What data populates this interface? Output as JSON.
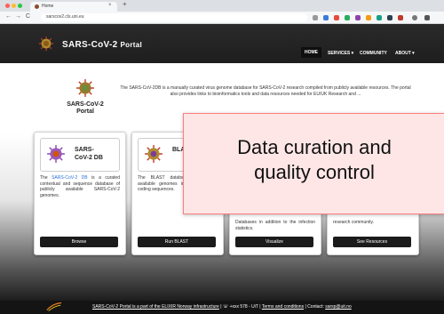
{
  "browser": {
    "tab_title": "Home",
    "tab_close": "×",
    "new_tab": "+",
    "url": "sarscov2.cls.uni.eu",
    "back": "←",
    "forward": "→",
    "reload": "C"
  },
  "site": {
    "brand_main": "SARS-CoV-2 ",
    "brand_small": "Portal",
    "nav": [
      {
        "label": "HOME"
      },
      {
        "label": "SERVICES ▾"
      },
      {
        "label": "COMMUNITY"
      },
      {
        "label": "ABOUT ▾"
      }
    ]
  },
  "intro": {
    "hero_name_line1": "SARS-CoV-2",
    "hero_name_line2": "Portal",
    "text": "The SARS-CoV-2DB is a manually curated virus genome database for SARS-CoV-2 research compiled from publicly available resources. The portal also provides links to bioinformatics tools and data resources needed for EU/UK Research and ..."
  },
  "cards": [
    {
      "title_line1": "SARS-",
      "title_line2": "CoV-2 DB",
      "text_prefix": "The ",
      "text_link": "SARS-CoV-2 DB",
      "text_suffix": " is a curated contextual and sequence database of publicly available SARS-CoV-2 genomes.",
      "button": "Browse"
    },
    {
      "title_line1": "BLAST",
      "title_line2": "",
      "text_prefix": "The BLAST database of publicly available genomes including protein-coding sequences.",
      "text_link": "",
      "text_suffix": "",
      "button": "Run BLAST"
    },
    {
      "title_line1": "",
      "title_line2": "",
      "text_prefix": "Databases in addition to the infection statistics.",
      "text_link": "",
      "text_suffix": "",
      "button": "Visualize"
    },
    {
      "title_line1": "",
      "title_line2": "",
      "text_prefix": "research community.",
      "text_link": "",
      "text_suffix": "",
      "button": "See Resources"
    }
  ],
  "footer": {
    "link1": "SARS-CoV-2 Portal is a part of the ELIXIR Norway infrastructure",
    "sep1": " | ",
    "contact1": "☏ +xxx 578 - UiT",
    "sep2": " | ",
    "link2": "Terms and conditions",
    "sep3": " | ",
    "contact_prefix": "Contact: ",
    "contact_email": "sarsp@uit.no"
  },
  "overlay": {
    "line1": "Data curation and",
    "line2": "quality control"
  },
  "colors": {
    "accent_link": "#2a6fdb",
    "nav_bg": "#1e1e1e",
    "callout_bg": "#ffe6e6",
    "callout_border": "#ff7e7e"
  }
}
